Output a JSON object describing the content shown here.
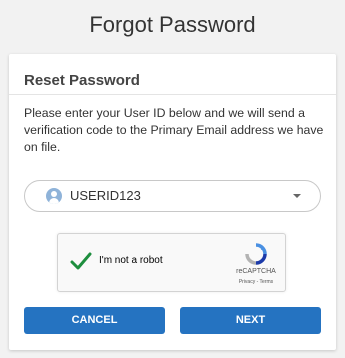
{
  "page": {
    "title": "Forgot Password"
  },
  "card": {
    "title": "Reset Password",
    "instructions": "Please enter your User ID below and we will send a verification code to the Primary Email address we have on file."
  },
  "user_select": {
    "value": "USERID123",
    "icon": "user-avatar-icon"
  },
  "captcha": {
    "label": "I'm not a robot",
    "brand": "reCAPTCHA",
    "links": "Privacy - Terms",
    "checked": true,
    "check_color": "#1e8e3e"
  },
  "buttons": {
    "cancel_label": "CANCEL",
    "next_label": "NEXT",
    "color": "#2573c1"
  }
}
